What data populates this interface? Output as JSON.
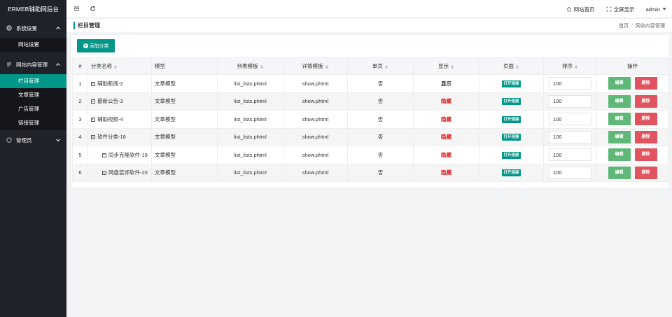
{
  "brand": "ERMEB辅助网后台",
  "sidebar": {
    "groups": [
      {
        "label": "系统设置",
        "icon": "gear-icon",
        "items": [
          "网站设置"
        ]
      },
      {
        "label": "网站内容管理",
        "icon": "list-icon",
        "items": [
          "栏目管理",
          "文章管理",
          "广告管理",
          "链接管理"
        ]
      },
      {
        "label": "管理员",
        "icon": "shield-icon",
        "items": []
      }
    ],
    "active": "栏目管理"
  },
  "topbar": {
    "site_home": "网站首页",
    "fullscreen": "全屏显示",
    "user": "admin"
  },
  "page": {
    "title": "栏目管理",
    "breadcrumb": [
      "首页",
      "网站内容管理"
    ],
    "add_button": "添加分类"
  },
  "table": {
    "headers": [
      "#",
      "分类名称",
      "模型",
      "列表模板",
      "详情模板",
      "单页",
      "显示",
      "页面",
      "排序",
      "操作"
    ],
    "open_link": "打开连接",
    "edit": "编辑",
    "delete": "删除",
    "rows": [
      {
        "id": "1",
        "name": "辅助新闻-2",
        "model": "文章模型",
        "list_tpl": "list_lists.phtml",
        "detail_tpl": "show.phtml",
        "single": "否",
        "display": "显示",
        "sort": "100",
        "child": false,
        "shown": true
      },
      {
        "id": "2",
        "name": "最新公告-3",
        "model": "文章模型",
        "list_tpl": "list_lists.phtml",
        "detail_tpl": "show.phtml",
        "single": "否",
        "display": "隐藏",
        "sort": "100",
        "child": false,
        "shown": false
      },
      {
        "id": "3",
        "name": "辅助视频-4",
        "model": "文章模型",
        "list_tpl": "list_lists.phtml",
        "detail_tpl": "show.phtml",
        "single": "否",
        "display": "隐藏",
        "sort": "100",
        "child": false,
        "shown": false
      },
      {
        "id": "4",
        "name": "软件分类-18",
        "model": "文章模型",
        "list_tpl": "list_lists.phtml",
        "detail_tpl": "show.phtml",
        "single": "否",
        "display": "隐藏",
        "sort": "100",
        "child": false,
        "shown": false
      },
      {
        "id": "5",
        "name": "同步克隆软件-19",
        "model": "文章模型",
        "list_tpl": "list_lists.phtml",
        "detail_tpl": "show.phtml",
        "single": "否",
        "display": "隐藏",
        "sort": "100",
        "child": true,
        "shown": false
      },
      {
        "id": "6",
        "name": "网盘装饰软件-20",
        "model": "文章模型",
        "list_tpl": "list_lists.phtml",
        "detail_tpl": "show.phtml",
        "single": "否",
        "display": "隐藏",
        "sort": "100",
        "child": true,
        "shown": false
      }
    ]
  }
}
